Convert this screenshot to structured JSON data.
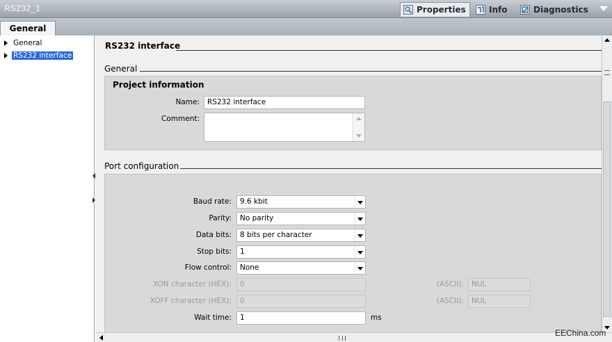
{
  "window": {
    "title": "RS232_1"
  },
  "top_tabs": [
    {
      "label": "Properties",
      "icon": "properties-icon",
      "active": true
    },
    {
      "label": "Info",
      "icon": "info-icon",
      "active": false
    },
    {
      "label": "Diagnostics",
      "icon": "diagnostics-icon",
      "active": false
    }
  ],
  "sub_tabs": {
    "general_label": "General"
  },
  "tree": {
    "items": [
      {
        "label": "General",
        "selected": false
      },
      {
        "label": "RS232 interface",
        "selected": true
      }
    ]
  },
  "content": {
    "page_title": "RS232 interface",
    "general_section": {
      "title": "General",
      "group_title": "Project information",
      "name_label": "Name:",
      "name_value": "RS232 interface",
      "comment_label": "Comment:",
      "comment_value": ""
    },
    "port_section": {
      "title": "Port configuration",
      "fields": {
        "baud_rate": {
          "label": "Baud rate:",
          "value": "9.6 kbit"
        },
        "parity": {
          "label": "Parity:",
          "value": "No parity"
        },
        "data_bits": {
          "label": "Data bits:",
          "value": "8 bits per character"
        },
        "stop_bits": {
          "label": "Stop bits:",
          "value": "1"
        },
        "flow_control": {
          "label": "Flow control:",
          "value": "None"
        },
        "xon_char": {
          "label": "XON character (HEX):",
          "value": "0",
          "ascii_label": "(ASCII):",
          "ascii_value": "NUL"
        },
        "xoff_char": {
          "label": "XOFF character (HEX):",
          "value": "0",
          "ascii_label": "(ASCII):",
          "ascii_value": "NUL"
        },
        "wait_time": {
          "label": "Wait time:",
          "value": "1",
          "unit": "ms"
        }
      }
    }
  },
  "watermark": "EEChina.com",
  "colors": {
    "selection": "#2a6ad8",
    "panel": "#f0f0f0",
    "group": "#d9d9d9"
  }
}
